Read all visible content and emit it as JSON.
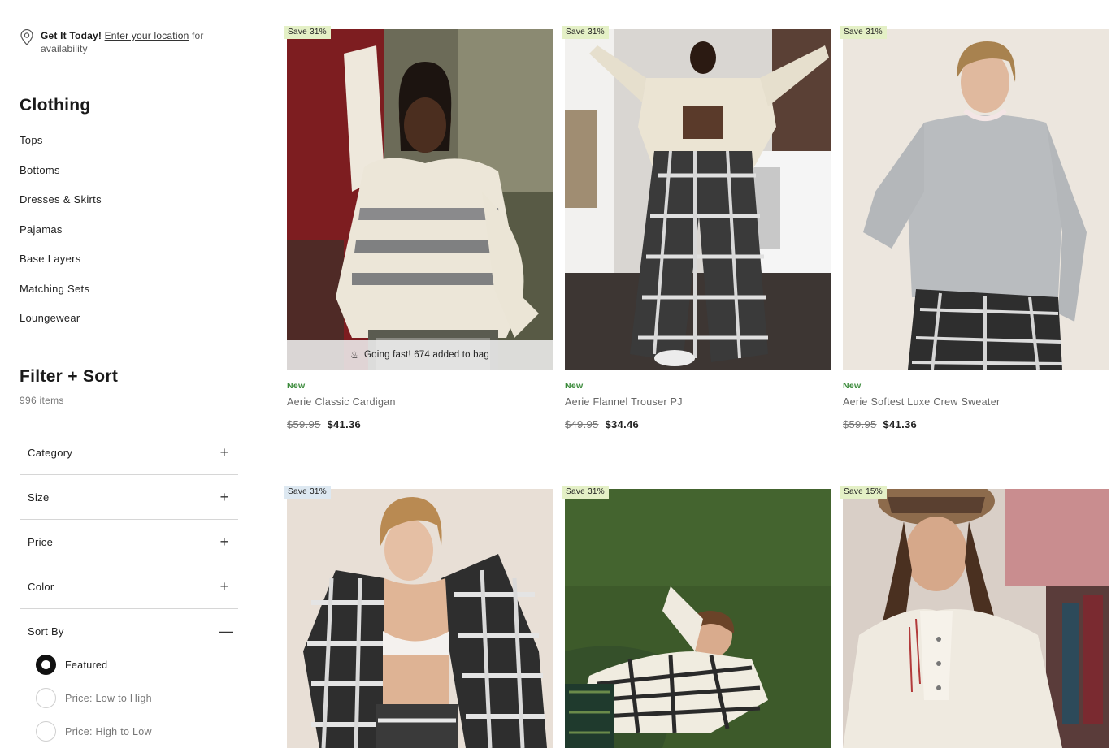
{
  "location": {
    "bold": "Get It Today!",
    "link": "Enter your location",
    "rest1": " for",
    "rest2": "availability"
  },
  "categories": {
    "title": "Clothing",
    "items": [
      "Tops",
      "Bottoms",
      "Dresses & Skirts",
      "Pajamas",
      "Base Layers",
      "Matching Sets",
      "Loungewear"
    ]
  },
  "filter": {
    "title": "Filter + Sort",
    "count": "996 items",
    "groups": [
      {
        "label": "Category",
        "sign": "+"
      },
      {
        "label": "Size",
        "sign": "+"
      },
      {
        "label": "Price",
        "sign": "+"
      },
      {
        "label": "Color",
        "sign": "+"
      },
      {
        "label": "Sort By",
        "sign": "—"
      }
    ],
    "sort_options": [
      {
        "label": "Featured",
        "selected": true
      },
      {
        "label": "Price: Low to High",
        "selected": false
      },
      {
        "label": "Price: High to Low",
        "selected": false
      }
    ]
  },
  "products": [
    {
      "badge": "Save 31%",
      "badge_color": "#e4f0c6",
      "urgency": "Going fast! 674 added to bag",
      "tag": "New",
      "name": "Aerie Classic Cardigan",
      "was": "$59.95",
      "now": "$41.36"
    },
    {
      "badge": "Save 31%",
      "badge_color": "#e4f0c6",
      "tag": "New",
      "name": "Aerie Flannel Trouser PJ",
      "was": "$49.95",
      "now": "$34.46"
    },
    {
      "badge": "Save 31%",
      "badge_color": "#e4f0c6",
      "tag": "New",
      "name": "Aerie Softest Luxe Crew Sweater",
      "was": "$59.95",
      "now": "$41.36"
    },
    {
      "badge": "Save 31%",
      "badge_color": "#dde8f1"
    },
    {
      "badge": "Save 31%",
      "badge_color": "#e4f0c6"
    },
    {
      "badge": "Save 15%",
      "badge_color": "#e4f0c6"
    }
  ]
}
